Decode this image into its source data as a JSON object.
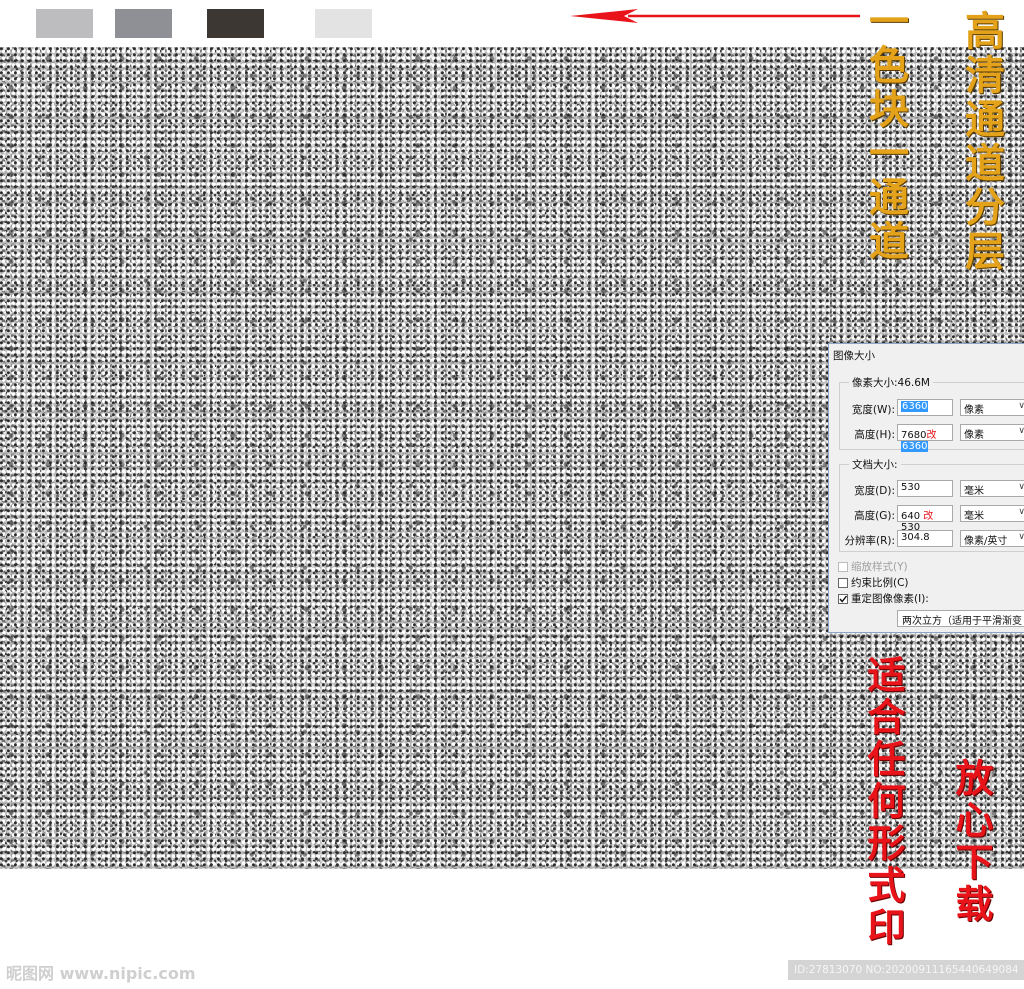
{
  "swatch_colors": [
    "#bdbdc0",
    "#8e9096",
    "#3c3733",
    "#e3e3e3"
  ],
  "annotations": {
    "swatch_note": "一色块一通道",
    "channel_note": "高清通道分层",
    "print_note": "适合任何形式印",
    "download_note": "放心下载"
  },
  "dialog": {
    "title": "图像大小",
    "pixel_group": "像素大小:46.6M",
    "width_label": "宽度(W):",
    "width_value": "6360",
    "width_unit": "像素",
    "height_label": "高度(H):",
    "height_old": "7680",
    "height_mark": "改",
    "height_value": "6360",
    "height_unit": "像素",
    "doc_group": "文档大小:",
    "doc_width_label": "宽度(D):",
    "doc_width_value": "530",
    "doc_width_unit": "毫米",
    "doc_height_label": "高度(G):",
    "doc_height_old": "640",
    "doc_height_mark": "改",
    "doc_height_value": "530",
    "doc_height_unit": "毫米",
    "res_label": "分辨率(R):",
    "res_value": "304.8",
    "res_unit": "像素/英寸",
    "scale_styles": "缩放样式(Y)",
    "constrain": "约束比例(C)",
    "resample": "重定图像像素(I):",
    "method": "两次立方（适用于平滑渐变"
  },
  "watermark": {
    "site": "昵图网 www.nipic.com",
    "id_text": "ID:27813070 NO:20200911165440649084"
  }
}
